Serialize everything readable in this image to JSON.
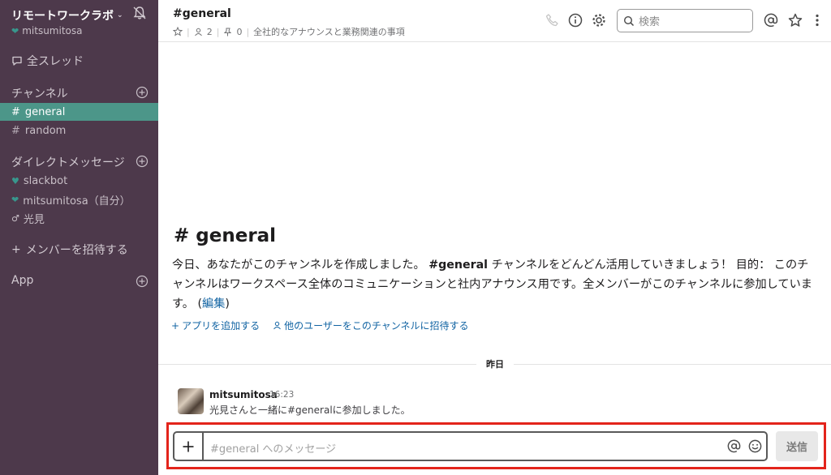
{
  "workspace": {
    "name": "リモートワークラボ",
    "user": "mitsumitosa"
  },
  "sidebar": {
    "all_threads": "全スレッド",
    "channels_header": "チャンネル",
    "channels": [
      {
        "label": "general",
        "active": true
      },
      {
        "label": "random",
        "active": false
      }
    ],
    "dm_header": "ダイレクトメッセージ",
    "dms": [
      {
        "label": "slackbot"
      },
      {
        "label": "mitsumitosa（自分）"
      },
      {
        "label": "光見"
      }
    ],
    "invite_members": "メンバーを招待する",
    "apps_header": "App"
  },
  "header": {
    "channel_title": "#general",
    "member_count": "2",
    "pinned_count": "0",
    "topic": "全社的なアナウンスと業務関連の事項",
    "search_placeholder": "検索"
  },
  "intro": {
    "title": "# general",
    "text_1": "今日、あなたがこのチャンネルを作成しました。",
    "channel_bold": "#general",
    "text_2": "チャンネルをどんどん活用していきましょう！ 目的： このチャンネルはワークスペース全体のコミュニケーションと社内アナウンス用です。全メンバーがこのチャンネルに参加しています。",
    "edit_open": "(",
    "edit_link": "編集",
    "edit_close": ")",
    "add_app": "アプリを追加する",
    "invite_users": "他のユーザーをこのチャンネルに招待する"
  },
  "divider": {
    "label": "昨日"
  },
  "message": {
    "user": "mitsumitosa",
    "time": "16:23",
    "text": "光見さんと一緒に#generalに参加しました。"
  },
  "composer": {
    "placeholder": "#general へのメッセージ",
    "send_label": "送信"
  },
  "colors": {
    "sidebar_bg": "#4d394b",
    "active_channel": "#4c9689",
    "link": "#1264a3",
    "highlight_border": "#e3241b"
  }
}
